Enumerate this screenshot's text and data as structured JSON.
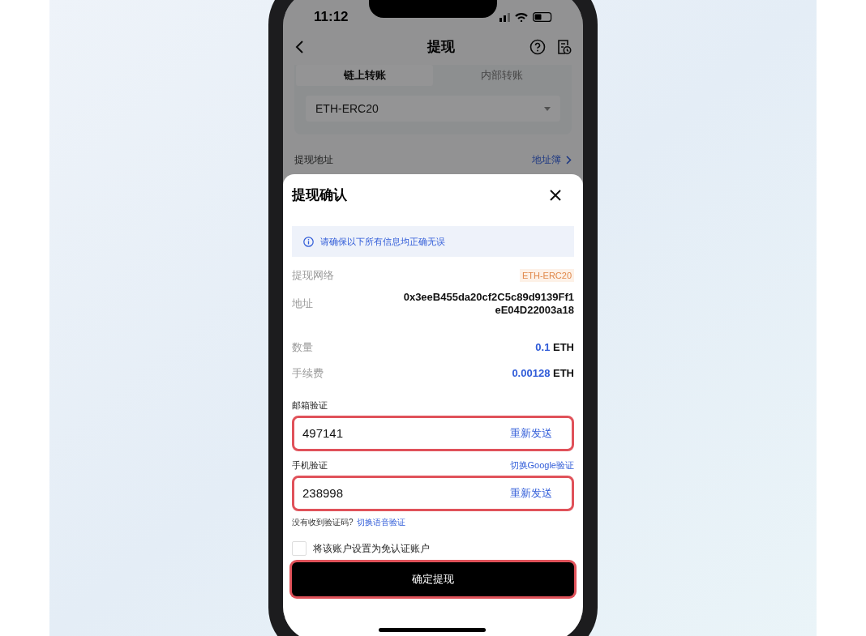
{
  "status_bar": {
    "time": "11:12"
  },
  "header": {
    "title": "提现"
  },
  "tabs": [
    {
      "label": "链上转账",
      "selected": true
    },
    {
      "label": "内部转账",
      "selected": false
    }
  ],
  "network_select": {
    "value": "ETH-ERC20"
  },
  "address_row": {
    "label": "提现地址",
    "link": "地址簿"
  },
  "sheet": {
    "title": "提现确认",
    "notice": "请确保以下所有信息均正确无误",
    "details": [
      {
        "kind": "tag",
        "label": "提现网络",
        "value": "ETH-ERC20"
      },
      {
        "kind": "address",
        "label": "地址",
        "lines": [
          "0x3eeB455da20cf2C5c89d9139Ff1",
          "eE04D22003a18"
        ]
      },
      {
        "kind": "amount",
        "label": "数量",
        "amount": "0.1",
        "unit": "ETH"
      },
      {
        "kind": "amount",
        "label": "手续费",
        "amount": "0.00128",
        "unit": "ETH"
      }
    ],
    "verifications": [
      {
        "label": "邮箱验证",
        "value": "497141",
        "resend": "重新发送",
        "highlighted": true
      },
      {
        "label": "手机验证",
        "switch_link": "切换Google验证",
        "value": "238998",
        "resend": "重新发送",
        "highlighted": true
      }
    ],
    "help": {
      "text": "没有收到验证码?",
      "link": "切换语音验证"
    },
    "exempt": {
      "label": "将该账户设置为免认证账户",
      "checked": false
    },
    "confirm_button": {
      "label": "确定提现",
      "highlighted": true
    }
  }
}
